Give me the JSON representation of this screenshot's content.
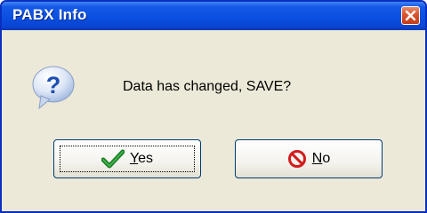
{
  "window": {
    "title": "PABX Info",
    "close_icon": "close-icon"
  },
  "dialog": {
    "icon": "question-icon",
    "message": "Data has changed,  SAVE?"
  },
  "buttons": {
    "yes": {
      "mnemonic": "Y",
      "rest": "es",
      "icon": "checkmark-icon"
    },
    "no": {
      "mnemonic": "N",
      "rest": "o",
      "icon": "no-entry-icon"
    }
  }
}
